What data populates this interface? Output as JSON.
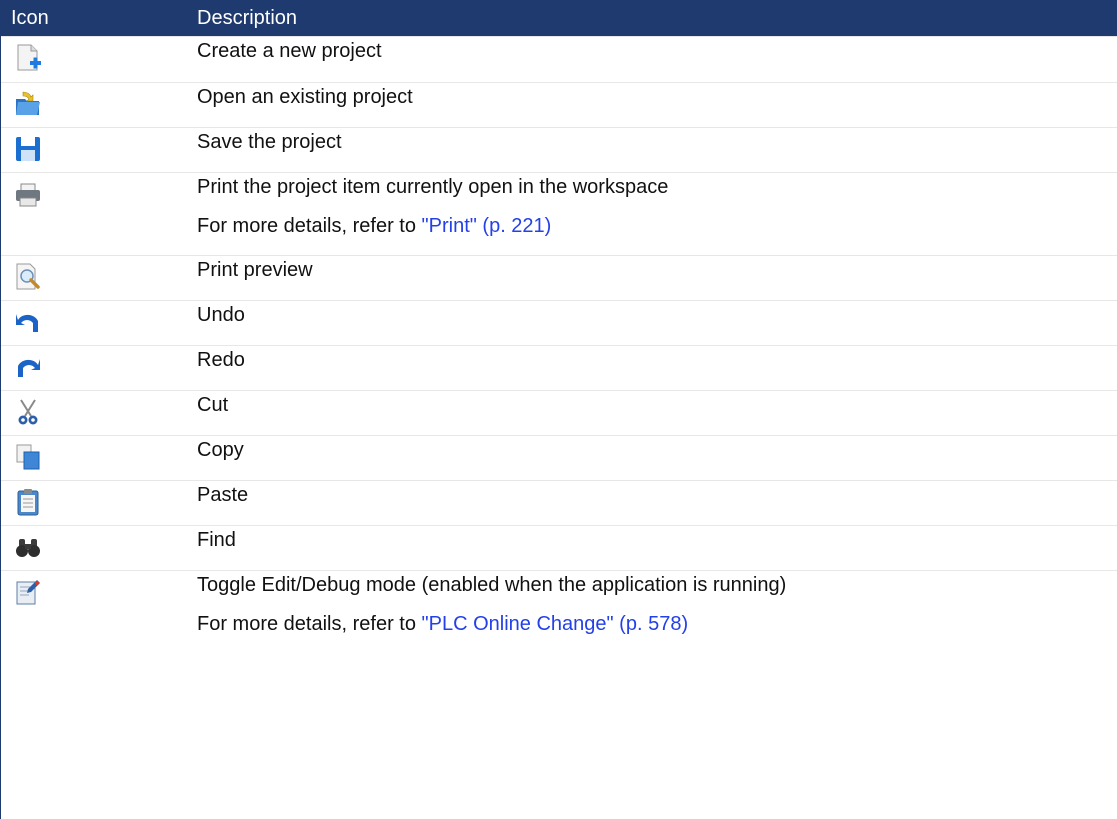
{
  "header": {
    "icon_col": "Icon",
    "desc_col": "Description"
  },
  "rows": [
    {
      "icon": "new-project-icon",
      "lines": [
        "Create a new project"
      ]
    },
    {
      "icon": "open-folder-icon",
      "lines": [
        "Open an existing project"
      ]
    },
    {
      "icon": "save-floppy-icon",
      "lines": [
        "Save the project"
      ]
    },
    {
      "icon": "printer-icon",
      "lines": [
        "Print the project item currently open in the workspace"
      ],
      "detail": {
        "prefix": "For more details, refer to ",
        "link": "\"Print\" (p. 221)"
      }
    },
    {
      "icon": "print-preview-icon",
      "lines": [
        "Print preview"
      ]
    },
    {
      "icon": "undo-icon",
      "lines": [
        "Undo"
      ]
    },
    {
      "icon": "redo-icon",
      "lines": [
        "Redo"
      ]
    },
    {
      "icon": "scissors-icon",
      "lines": [
        "Cut"
      ]
    },
    {
      "icon": "copy-icon",
      "lines": [
        "Copy"
      ]
    },
    {
      "icon": "paste-clipboard-icon",
      "lines": [
        "Paste"
      ]
    },
    {
      "icon": "binoculars-icon",
      "lines": [
        "Find"
      ]
    },
    {
      "icon": "edit-debug-toggle-icon",
      "lines": [
        "Toggle Edit/Debug mode (enabled when the application is running)"
      ],
      "detail": {
        "prefix": "For more details, refer to ",
        "link": "\"PLC Online Change\" (p. 578)"
      }
    }
  ],
  "colors": {
    "header_bg": "#1e3a6e",
    "link": "#2440e8"
  }
}
